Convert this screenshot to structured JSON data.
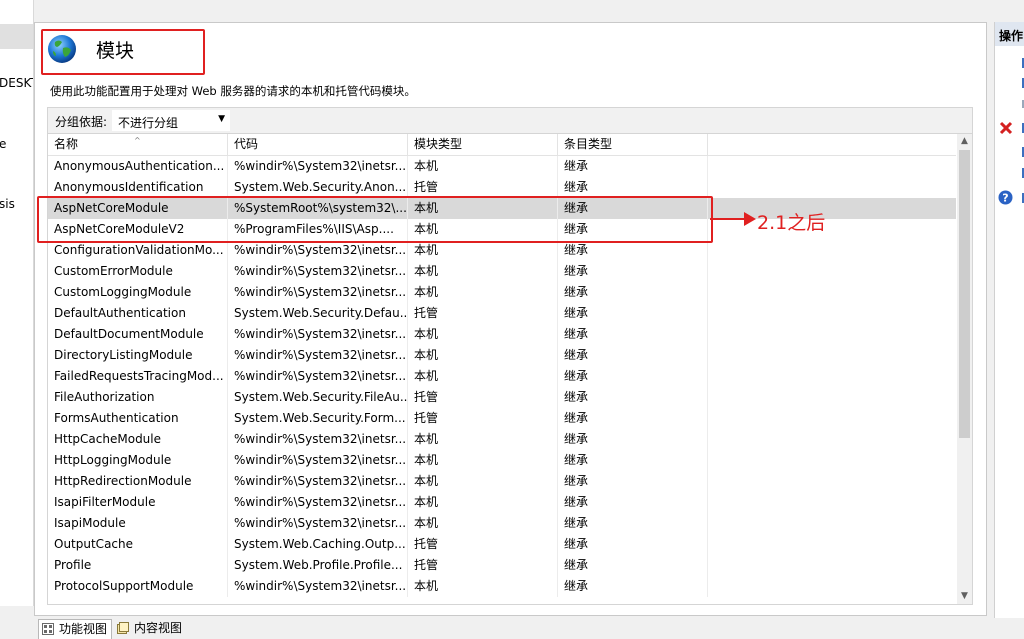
{
  "left_panel": {
    "fragments": [
      "DESKT",
      "e",
      "sis"
    ]
  },
  "feature": {
    "title": "模块",
    "description": "使用此功能配置用于处理对 Web 服务器的请求的本机和托管代码模块。",
    "group_by_label": "分组依据:",
    "group_by_value": "不进行分组"
  },
  "grid": {
    "columns": [
      "名称",
      "代码",
      "模块类型",
      "条目类型"
    ],
    "rows": [
      {
        "name": "AnonymousAuthentication...",
        "code": "%windir%\\System32\\inetsr...",
        "type": "本机",
        "entry": "继承"
      },
      {
        "name": "AnonymousIdentification",
        "code": "System.Web.Security.Anon...",
        "type": "托管",
        "entry": "继承"
      },
      {
        "name": "AspNetCoreModule",
        "code": "%SystemRoot%\\system32\\...",
        "type": "本机",
        "entry": "继承"
      },
      {
        "name": "AspNetCoreModuleV2",
        "code": "%ProgramFiles%\\IIS\\Asp....",
        "type": "本机",
        "entry": "继承"
      },
      {
        "name": "ConfigurationValidationMo...",
        "code": "%windir%\\System32\\inetsr...",
        "type": "本机",
        "entry": "继承"
      },
      {
        "name": "CustomErrorModule",
        "code": "%windir%\\System32\\inetsr...",
        "type": "本机",
        "entry": "继承"
      },
      {
        "name": "CustomLoggingModule",
        "code": "%windir%\\System32\\inetsr...",
        "type": "本机",
        "entry": "继承"
      },
      {
        "name": "DefaultAuthentication",
        "code": "System.Web.Security.Defau...",
        "type": "托管",
        "entry": "继承"
      },
      {
        "name": "DefaultDocumentModule",
        "code": "%windir%\\System32\\inetsr...",
        "type": "本机",
        "entry": "继承"
      },
      {
        "name": "DirectoryListingModule",
        "code": "%windir%\\System32\\inetsr...",
        "type": "本机",
        "entry": "继承"
      },
      {
        "name": "FailedRequestsTracingMod...",
        "code": "%windir%\\System32\\inetsr...",
        "type": "本机",
        "entry": "继承"
      },
      {
        "name": "FileAuthorization",
        "code": "System.Web.Security.FileAu...",
        "type": "托管",
        "entry": "继承"
      },
      {
        "name": "FormsAuthentication",
        "code": "System.Web.Security.Form...",
        "type": "托管",
        "entry": "继承"
      },
      {
        "name": "HttpCacheModule",
        "code": "%windir%\\System32\\inetsr...",
        "type": "本机",
        "entry": "继承"
      },
      {
        "name": "HttpLoggingModule",
        "code": "%windir%\\System32\\inetsr...",
        "type": "本机",
        "entry": "继承"
      },
      {
        "name": "HttpRedirectionModule",
        "code": "%windir%\\System32\\inetsr...",
        "type": "本机",
        "entry": "继承"
      },
      {
        "name": "IsapiFilterModule",
        "code": "%windir%\\System32\\inetsr...",
        "type": "本机",
        "entry": "继承"
      },
      {
        "name": "IsapiModule",
        "code": "%windir%\\System32\\inetsr...",
        "type": "本机",
        "entry": "继承"
      },
      {
        "name": "OutputCache",
        "code": "System.Web.Caching.Outp...",
        "type": "托管",
        "entry": "继承"
      },
      {
        "name": "Profile",
        "code": "System.Web.Profile.Profile...",
        "type": "托管",
        "entry": "继承"
      },
      {
        "name": "ProtocolSupportModule",
        "code": "%windir%\\System32\\inetsr...",
        "type": "本机",
        "entry": "继承"
      }
    ]
  },
  "annotation": {
    "text": "2.1之后",
    "color": "#e02020"
  },
  "bottom_tabs": [
    "功能视图",
    "内容视图"
  ],
  "actions_pane": {
    "title": "操作"
  },
  "colors": {
    "selected_row": "#d9d9d9",
    "annotation_red": "#e02020",
    "link_blue": "#3c6fbf"
  }
}
